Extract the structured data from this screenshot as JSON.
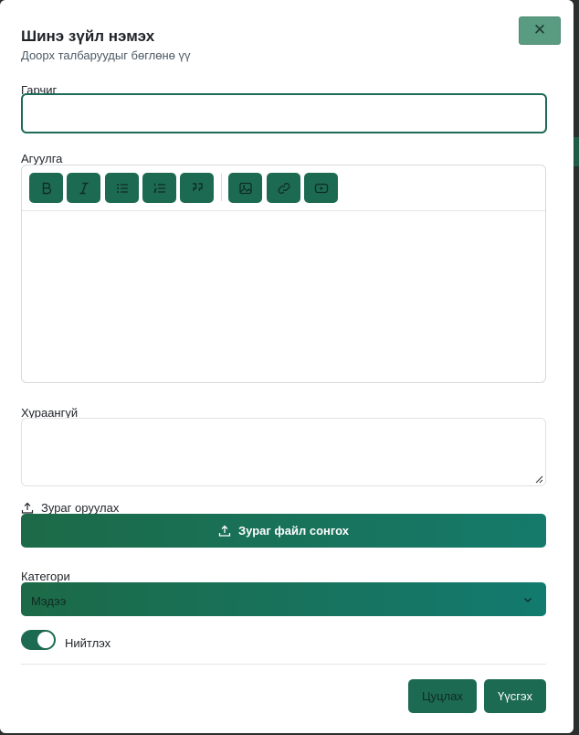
{
  "dialog": {
    "title": "Шинэ зүйл нэмэх",
    "subtitle": "Доорх талбаруудыг бөглөнө үү",
    "close_label": "✕"
  },
  "form": {
    "title_label": "Гарчиг",
    "title_value": "",
    "content_label": "Агуулга",
    "summary_label": "Хураангуй",
    "summary_value": "",
    "upload_label": "Зураг оруулах",
    "upload_button": "Зураг файл сонгох",
    "category_label": "Категори",
    "category_value": "Мэдээ",
    "publish_label": "Нийтлэх",
    "publish_on": true
  },
  "toolbar": {
    "buttons": [
      "bold-icon",
      "italic-icon",
      "bullet-list-icon",
      "numbered-list-icon",
      "quote-icon",
      "image-icon",
      "link-icon",
      "video-icon"
    ]
  },
  "actions": {
    "cancel_label": "Цуцлах",
    "create_label": "Үүсгэх"
  },
  "colors": {
    "primary": "#1d6a52",
    "gradient_end": "#157a6b",
    "close_button": "#5a9c82"
  }
}
